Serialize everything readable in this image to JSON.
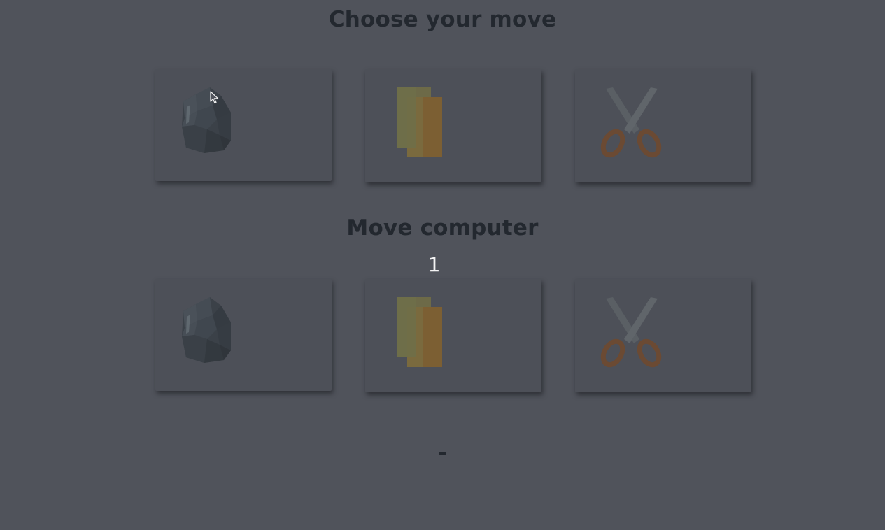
{
  "player": {
    "heading": "Choose your move",
    "choices": [
      {
        "name": "rock",
        "icon": "rock-icon"
      },
      {
        "name": "paper",
        "icon": "paper-icon"
      },
      {
        "name": "scissors",
        "icon": "scissors-icon"
      }
    ]
  },
  "computer": {
    "heading": "Move computer",
    "countdown": "1",
    "choices": [
      {
        "name": "rock",
        "icon": "rock-icon"
      },
      {
        "name": "paper",
        "icon": "paper-icon"
      },
      {
        "name": "scissors",
        "icon": "scissors-icon"
      }
    ]
  },
  "result": {
    "text": "-"
  },
  "colors": {
    "background": "#50535b",
    "card": "#4d5058",
    "heading": "#23282f",
    "counter": "#f4f4f4",
    "paper": "#7a6f45",
    "scissors_handle": "#6b4a33",
    "scissors_blade": "#5d6267",
    "rock": "#3d434a"
  }
}
